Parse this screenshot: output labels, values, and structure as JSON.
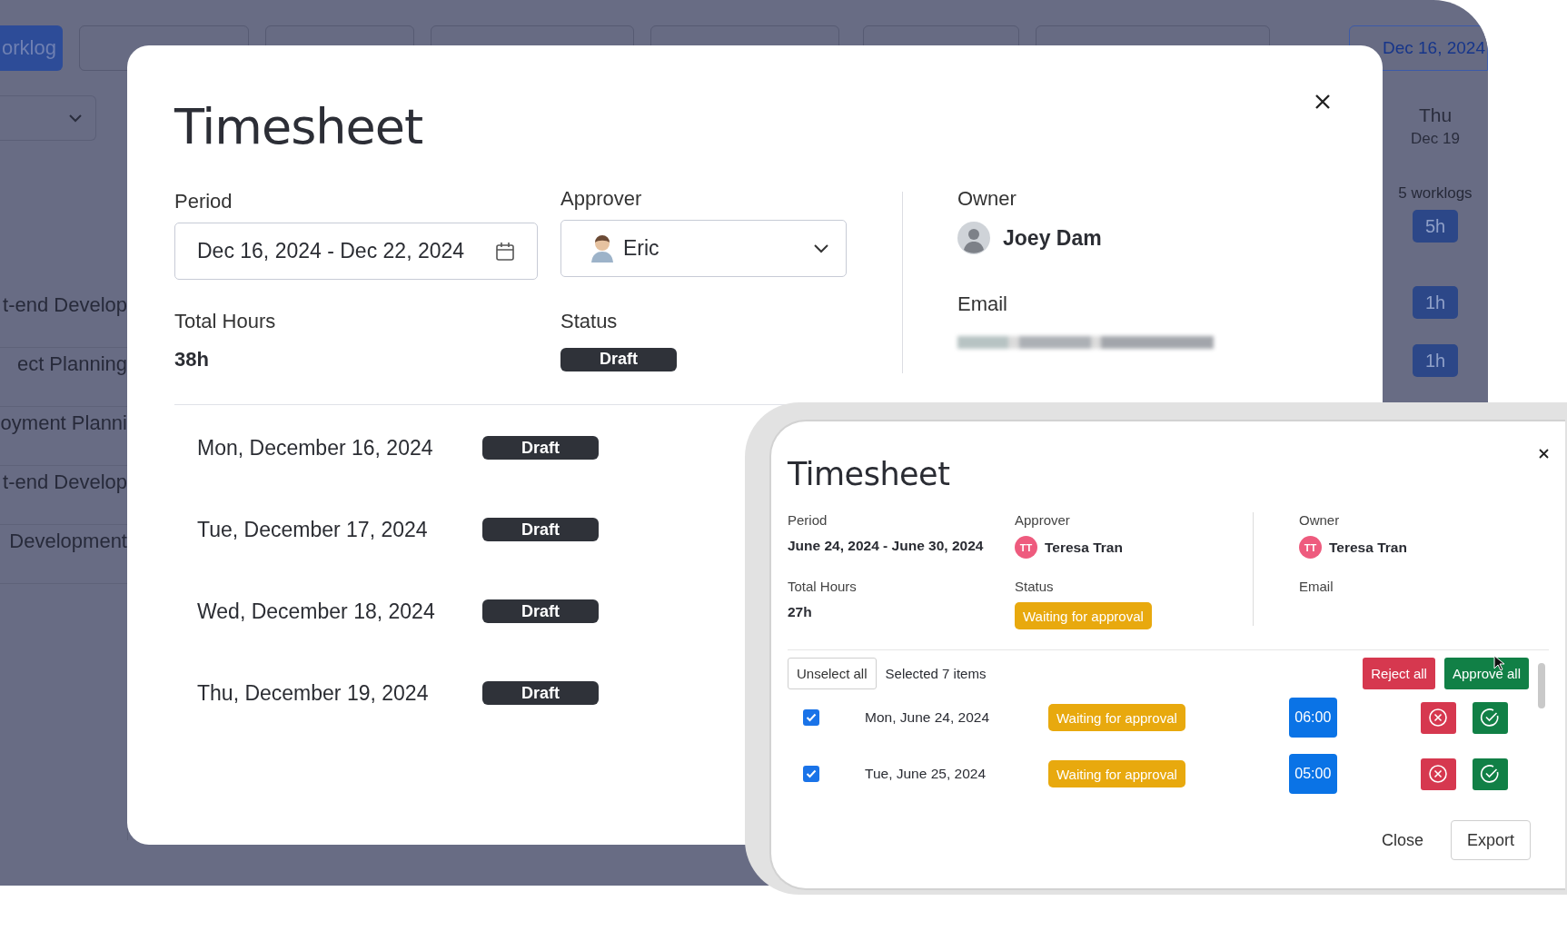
{
  "background_app": {
    "worklog_button": "orklog",
    "date_button": "Dec 16, 2024",
    "list_items": [
      "t-end Develop",
      "ect Planning",
      "oyment Planni",
      "t-end Develop",
      "Development"
    ],
    "day_column": {
      "weekday": "Thu",
      "date": "Dec 19",
      "summary": "5 worklogs",
      "total": "5h",
      "entries": [
        "1h",
        "1h"
      ]
    }
  },
  "timesheet_modal": {
    "title": "Timesheet",
    "period": {
      "label": "Period",
      "value": "Dec 16, 2024 - Dec 22, 2024"
    },
    "approver": {
      "label": "Approver",
      "value": "Eric"
    },
    "owner": {
      "label": "Owner",
      "name": "Joey Dam"
    },
    "email": {
      "label": "Email"
    },
    "total_hours": {
      "label": "Total Hours",
      "value": "38h"
    },
    "status": {
      "label": "Status",
      "value": "Draft"
    },
    "days": [
      {
        "date": "Mon, December 16, 2024",
        "status": "Draft"
      },
      {
        "date": "Tue, December 17, 2024",
        "status": "Draft"
      },
      {
        "date": "Wed, December 18, 2024",
        "status": "Draft"
      },
      {
        "date": "Thu, December 19, 2024",
        "status": "Draft"
      }
    ]
  },
  "approval_modal": {
    "title": "Timesheet",
    "period": {
      "label": "Period",
      "value": "June 24, 2024 - June 30, 2024"
    },
    "approver": {
      "label": "Approver",
      "initials": "TT",
      "name": "Teresa Tran"
    },
    "owner": {
      "label": "Owner",
      "initials": "TT",
      "name": "Teresa Tran"
    },
    "email": {
      "label": "Email"
    },
    "total_hours": {
      "label": "Total Hours",
      "value": "27h"
    },
    "status": {
      "label": "Status",
      "value": "Waiting for approval"
    },
    "unselect_button": "Unselect all",
    "selection_text": "Selected 7 items",
    "reject_all_button": "Reject all",
    "approve_all_button": "Approve all",
    "rows": [
      {
        "checked": true,
        "date": "Mon, June 24, 2024",
        "status": "Waiting for approval",
        "hours": "06:00"
      },
      {
        "checked": true,
        "date": "Tue, June 25, 2024",
        "status": "Waiting for approval",
        "hours": "05:00"
      }
    ],
    "close_button": "Close",
    "export_button": "Export"
  }
}
